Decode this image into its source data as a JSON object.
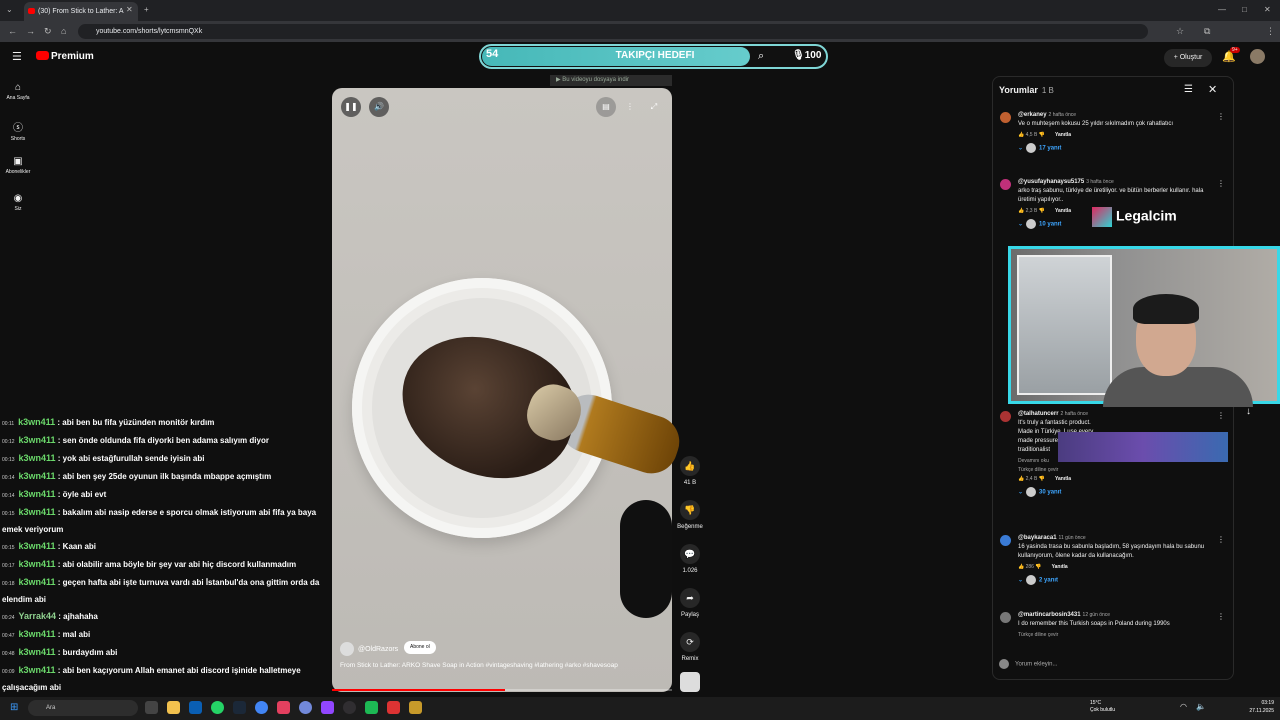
{
  "browser": {
    "tab_title": "(30) From Stick to Lather: A",
    "url": "youtube.com/shorts/lytcmsmnQXk"
  },
  "header": {
    "brand": "Premium",
    "goal_start": "54",
    "goal_title": "TAKIPÇI HEDEFI",
    "goal_end": "100",
    "create_label": "Oluştur",
    "notification_count": "9+"
  },
  "sidebar": {
    "items": [
      {
        "label": "Ana Sayfa",
        "icon": "home-icon"
      },
      {
        "label": "Shorts",
        "icon": "shorts-icon"
      },
      {
        "label": "Abonelikler",
        "icon": "subscriptions-icon"
      },
      {
        "label": "Siz",
        "icon": "you-icon"
      }
    ]
  },
  "video": {
    "download_bar": "Bu videoyu dosyaya indir",
    "channel": "@OldRazors",
    "subscribe": "Abone ol",
    "title": "From Stick to Lather: ARKO Shave Soap in Action #vintageshaving #lathering #arko #shavesoap",
    "progress": 0.51
  },
  "actions": {
    "likes": "41 B",
    "dislike": "Beğenme",
    "comments": "1.026",
    "share": "Paylaş",
    "remix": "Remix"
  },
  "chat": [
    {
      "time": "00:11",
      "user": "k3wn411",
      "text": ": abi ben bu fifa yüzünden monitör kırdım"
    },
    {
      "time": "00:12",
      "user": "k3wn411",
      "text": ": sen önde oldunda fifa diyorki ben adama salıyım diyor"
    },
    {
      "time": "00:13",
      "user": "k3wn411",
      "text": ": yok abi estağfurullah sende iyisin abi"
    },
    {
      "time": "00:14",
      "user": "k3wn411",
      "text": ": abi ben şey 25de oyunun ilk başında mbappe açmıştım"
    },
    {
      "time": "00:14",
      "user": "k3wn411",
      "text": ": öyle abi evt"
    },
    {
      "time": "00:15",
      "user": "k3wn411",
      "text": ": bakalım abi nasip ederse e sporcu olmak istiyorum abi fifa ya baya emek veriyorum"
    },
    {
      "time": "00:15",
      "user": "k3wn411",
      "text": ": Kaan abi"
    },
    {
      "time": "00:17",
      "user": "k3wn411",
      "text": ": abi olabilir ama böyle bir şey var abi hiç discord kullanmadım"
    },
    {
      "time": "00:18",
      "user": "k3wn411",
      "text": ": geçen hafta abi işte turnuva vardı abi İstanbul'da ona gittim orda da elendim abi"
    },
    {
      "time": "00:24",
      "user": "Yarrak44",
      "text": ": ajhahaha"
    },
    {
      "time": "00:47",
      "user": "k3wn411",
      "text": ": mal abi"
    },
    {
      "time": "00:48",
      "user": "k3wn411",
      "text": ": burdaydım abi"
    },
    {
      "time": "00:09",
      "user": "k3wn411",
      "text": ": abi ben kaçıyorum Allah emanet abi discord işinide halletmeye çalışacağım abi"
    }
  ],
  "comments": {
    "title": "Yorumlar",
    "count": "1 B",
    "add_placeholder": "Yorum ekleyin...",
    "items": [
      {
        "user": "@erkaney",
        "ago": "2 hafta önce",
        "text": "Ve o muhteşem kokusu 25 yıldır sıkılmadım çok rahatlatıcı",
        "likes": "4,5 B",
        "reply": "Yanıtla",
        "replies": "17 yanıt",
        "translate": ""
      },
      {
        "user": "@yusufayhanaysu5175",
        "ago": "3 hafta önce",
        "text": "arko traş sabunu, türkiye de üretiliyor. ve bütün berberler kullanır. hala üretimi yapılıyor..",
        "likes": "2,3 B",
        "reply": "Yanıtla",
        "replies": "10 yanıt",
        "translate": ""
      },
      {
        "user": "@talhatuncerr",
        "ago": "2 hafta önce",
        "text": "It's truly a fantastic product. Made in Türkiye. I use every made pressure still sold as traditionalist",
        "more": "Devamını oku",
        "translate": "Türkçe diline çevir",
        "likes": "2,4 B",
        "reply": "Yanıtla",
        "replies": "30 yanıt"
      },
      {
        "user": "@baykaraca1",
        "ago": "11 gün önce",
        "text": "16 yasinda trasa bu sabunla başladım, 58 yaşındayım hala bu sabunu kullanıyorum, ölene kadar da kullanacağım.",
        "likes": "286",
        "reply": "Yanıtla",
        "replies": "2 yanıt",
        "translate": ""
      },
      {
        "user": "@martincarbosin3431",
        "ago": "12 gün önce",
        "text": "I do remember this Turkish soaps in Poland during 1990s",
        "translate": "Türkçe diline çevir",
        "likes": "",
        "reply": "",
        "replies": ""
      }
    ]
  },
  "overlay": {
    "legal_brand": "Legalcim"
  },
  "taskbar": {
    "search": "Ara",
    "weather_temp": "15°C",
    "weather_desc": "Çok bulutlu",
    "time": "03:19",
    "date": "27.11.2025"
  },
  "colors": {
    "goal_teal": "#66cccc",
    "chat_user": "#6bd96b",
    "accent_red": "#ff0000",
    "link_blue": "#3ea6ff"
  }
}
